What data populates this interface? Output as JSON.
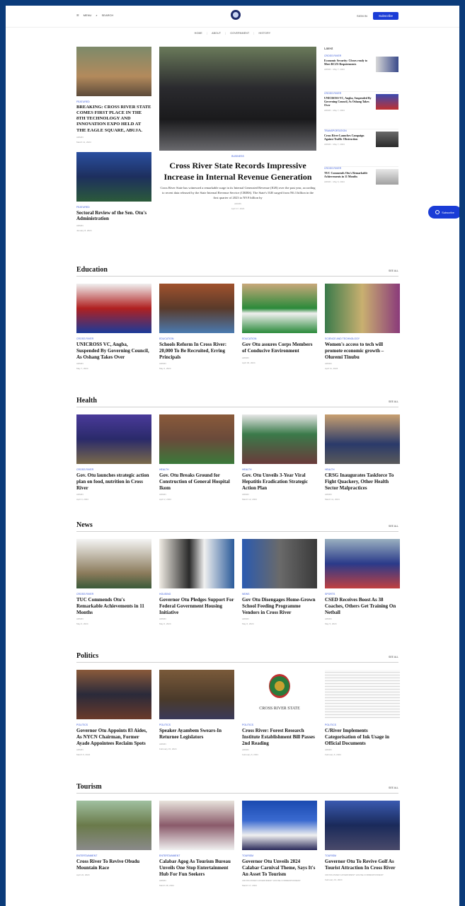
{
  "header": {
    "menu_label": "MENU",
    "search_label": "SEARCH",
    "signin": "SIGN IN",
    "subscribe": "Subscribe"
  },
  "nav": [
    "HOME",
    "ABOUT",
    "GOVERNMENT",
    "HISTORY"
  ],
  "hero": {
    "left_top": {
      "category": "FEATURED",
      "title": "BREAKING: CROSS RIVER STATE COMES FIRST PLACE IN THE 8TH TECHNOLOGY AND INNOVATION EXPO HELD AT THE EAGLE SQUARE, ABUJA.",
      "author": "ADMIN",
      "date": "March 11, 2024"
    },
    "left_bottom": {
      "category": "FEATURED",
      "title": "Sectoral Review of the Sen. Otu's Administration",
      "author": "ADMIN",
      "date": "January 8, 2024"
    },
    "lead": {
      "category": "BUSINESS",
      "title": "Cross River State Records Impressive Increase in Internal Revenue Generation",
      "excerpt": "Cross River State has witnessed a remarkable surge in its Internal Generated Revenue (IGR) over the past year, according to recent data released by the State Internal Revenue Service (CRIRS). The State's IGR surged from N6.3 billion in the first quarter of 2023 to N9.9 billion by",
      "author": "ADMIN",
      "date": "April 17, 2024"
    },
    "latest_heading": "Latest",
    "latest": [
      {
        "category": "CROSS RIVER",
        "title": "Economic Security: Cfcnrs ready to Meet RCZS Requirements",
        "date": "ADMIN · May 7, 2024"
      },
      {
        "category": "CROSS RIVER",
        "title": "UNICROSS VC, Angba, Suspended By Governing Council, As Oshang Takes Over",
        "date": "ADMIN · May 7, 2024"
      },
      {
        "category": "TRANSPORTATION",
        "title": "Cross River Launches Campaign Against Traffic Obstruction",
        "date": "ADMIN · May 7, 2024"
      },
      {
        "category": "CROSS RIVER",
        "title": "TUC Commends Otu's Remarkable Achievements in 11 Months",
        "date": "ADMIN · May 6, 2024"
      }
    ]
  },
  "float_subscribe": "Subscribe",
  "sections": [
    {
      "name": "Education",
      "see_all": "SEE ALL",
      "cards": [
        {
          "category": "CROSS RIVER",
          "title": "UNICROSS VC, Angba, Suspended By Governing Council, As Oshang Takes Over",
          "author": "ADMIN",
          "date": "May 7, 2024"
        },
        {
          "category": "EDUCATION",
          "title": "Schools Reform In Cross River: 20,000 To Be Recruited, Erring Principals",
          "author": "ADMIN",
          "date": "May 2, 2024"
        },
        {
          "category": "EDUCATION",
          "title": "Gov Otu assures Corps Members of Conducive Environment",
          "author": "ADMIN",
          "date": "April 30, 2024"
        },
        {
          "category": "SCIENCE AND TECHNOLOGY",
          "title": "Women's access to tech will promote economic growth – Oluremi Tinubu",
          "author": "ADMIN",
          "date": "April 11, 2024"
        }
      ]
    },
    {
      "name": "Health",
      "see_all": "SEE ALL",
      "cards": [
        {
          "category": "CROSS RIVER",
          "title": "Gov. Otu launches strategic action plan on food, nutrition in Cross River",
          "author": "ADMIN",
          "date": "April 3, 2024"
        },
        {
          "category": "HEALTH",
          "title": "Gov. Otu Breaks Ground for Construction of General Hospital Ikom",
          "author": "ADMIN",
          "date": "April 2, 2024"
        },
        {
          "category": "HEALTH",
          "title": "Gov. Otu Unveils 3-Year Viral Hepatitis Eradication Strategic Action Plan",
          "author": "ADMIN",
          "date": "March 12, 2024"
        },
        {
          "category": "HEALTH",
          "title": "CRSG Inaugurates Taskforce To Fight Quackery, Other Health Sector Malpractices",
          "author": "ADMIN",
          "date": "March 11, 2024"
        }
      ]
    },
    {
      "name": "News",
      "see_all": "SEE ALL",
      "cards": [
        {
          "category": "CROSS RIVER",
          "title": "TUC Commends Otu's Remarkable Achievements in 11 Months",
          "author": "ADMIN",
          "date": "May 6, 2024"
        },
        {
          "category": "HOUSING",
          "title": "Governor Otu Pledges Support For Federal Government Housing Initiative",
          "author": "ADMIN",
          "date": "May 6, 2024"
        },
        {
          "category": "NEWS",
          "title": "Gov Otu Disengages Home-Grown School Feeding Programme Vendors in Cross River",
          "author": "ADMIN",
          "date": "May 6, 2024"
        },
        {
          "category": "SPORTS",
          "title": "CSED Receives Boost As 38 Coaches, Others Get Training On Netball",
          "author": "ADMIN",
          "date": "May 5, 2024"
        }
      ]
    },
    {
      "name": "Politics",
      "see_all": "SEE ALL",
      "cards": [
        {
          "category": "POLITICS",
          "title": "Governor Otu Appoints 83 Aides, As NYCN Chairman, Former Ayade Appointees Reclaim Spots",
          "author": "ADMIN",
          "date": "March 6, 2024"
        },
        {
          "category": "POLITICS",
          "title": "Speaker Ayambem Swears-In Returnee Legislators",
          "author": "ADMIN",
          "date": "February 15, 2024"
        },
        {
          "category": "POLITICS",
          "title": "Cross River: Forest Research Institute Establishment Bill Passes 2nd Reading",
          "author": "ADMIN",
          "date": "February 6, 2024"
        },
        {
          "category": "POLITICS",
          "title": "C/River Implements Categorisation of Ink Usage in Official Documents",
          "author": "ADMIN",
          "date": "February 6, 2024"
        }
      ]
    },
    {
      "name": "Tourism",
      "see_all": "SEE ALL",
      "cards": [
        {
          "category": "ENTERTAINMENT",
          "title": "Cross River To Revive Obudu Mountain Race",
          "author": "",
          "date": "April 22, 2024"
        },
        {
          "category": "ENTERTAINMENT",
          "title": "Calabar Agog As Tourism Bureau Unveils One Stop Entertainment Hub For Fun Seekers",
          "author": "ADMIN",
          "date": "March 28, 2024"
        },
        {
          "category": "TOURISM",
          "title": "Governor Otu Unveils 2024 Calabar Carnival Theme, Says It's An Asset To Tourism",
          "author": "CROSS RIVER GOVERNMENT HOUSE CORRESPONDENT",
          "date": "March 17, 2024"
        },
        {
          "category": "TOURISM",
          "title": "Governor Otu To Revive Golf As Tourist Attraction In Cross River",
          "author": "CROSS RIVER GOVERNMENT HOUSE CORRESPONDENT",
          "date": "February 13, 2024"
        }
      ]
    }
  ],
  "politics_logo_text": "CROSS RIVER STATE"
}
